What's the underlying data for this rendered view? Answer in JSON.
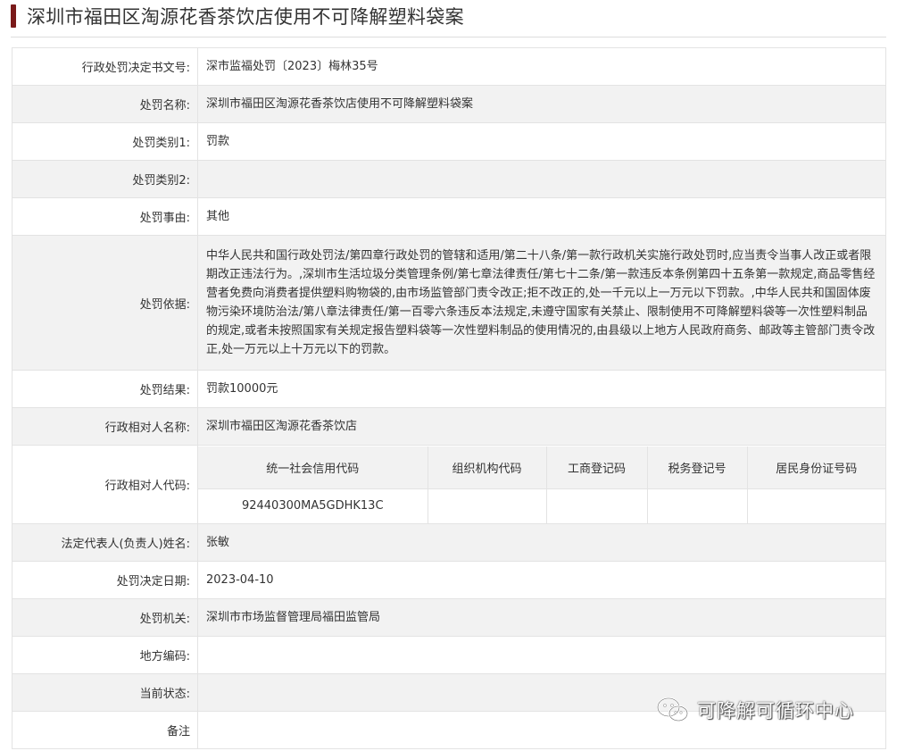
{
  "page": {
    "title": "深圳市福田区淘源花香茶饮店使用不可降解塑料袋案",
    "accent_color": "#7a1a1a"
  },
  "rows": [
    {
      "label": "行政处罚决定书文号:",
      "value": "深市监福处罚〔2023〕梅林35号"
    },
    {
      "label": "处罚名称:",
      "value": "深圳市福田区淘源花香茶饮店使用不可降解塑料袋案"
    },
    {
      "label": "处罚类别1:",
      "value": "罚款"
    },
    {
      "label": "处罚类别2:",
      "value": ""
    },
    {
      "label": "处罚事由:",
      "value": "其他"
    },
    {
      "label": "处罚依据:",
      "value": "中华人民共和国行政处罚法/第四章行政处罚的管辖和适用/第二十八条/第一款行政机关实施行政处罚时,应当责令当事人改正或者限期改正违法行为。,深圳市生活垃圾分类管理条例/第七章法律责任/第七十二条/第一款违反本条例第四十五条第一款规定,商品零售经营者免费向消费者提供塑料购物袋的,由市场监管部门责令改正;拒不改正的,处一千元以上一万元以下罚款。,中华人民共和国固体废物污染环境防治法/第八章法律责任/第一百零六条违反本法规定,未遵守国家有关禁止、限制使用不可降解塑料袋等一次性塑料制品的规定,或者未按照国家有关规定报告塑料袋等一次性塑料制品的使用情况的,由县级以上地方人民政府商务、邮政等主管部门责令改正,处一万元以上十万元以下的罚款。"
    },
    {
      "label": "处罚结果:",
      "value": "罚款10000元"
    },
    {
      "label": "行政相对人名称:",
      "value": "深圳市福田区淘源花香茶饮店"
    },
    {
      "label": "法定代表人(负责人)姓名:",
      "value": "张敏"
    },
    {
      "label": "处罚决定日期:",
      "value": "2023-04-10"
    },
    {
      "label": "处罚机关:",
      "value": "深圳市市场监督管理局福田监管局"
    },
    {
      "label": "地方编码:",
      "value": ""
    },
    {
      "label": "当前状态:",
      "value": ""
    },
    {
      "label": "备注",
      "value": ""
    }
  ],
  "party_codes": {
    "label": "行政相对人代码:",
    "headers": [
      "统一社会信用代码",
      "组织机构代码",
      "工商登记码",
      "税务登记号",
      "居民身份证号码"
    ],
    "values": [
      "92440300MA5GDHK13C",
      "",
      "",
      "",
      ""
    ]
  },
  "watermark": {
    "text": "可降解可循环中心",
    "icon": "wechat-icon"
  }
}
